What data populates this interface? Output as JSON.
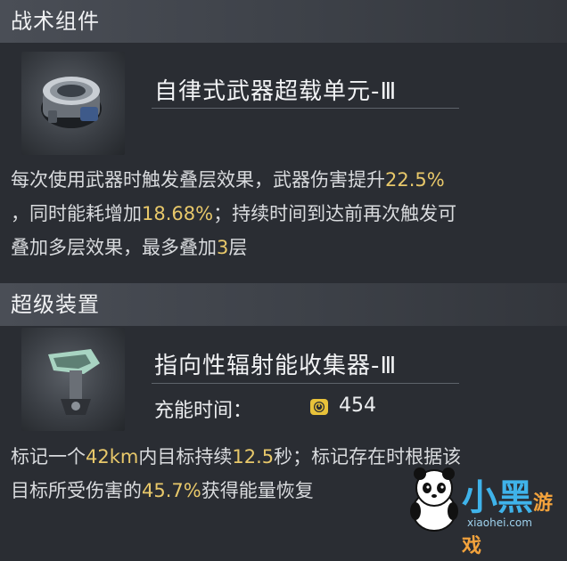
{
  "sections": [
    {
      "title": "战术组件"
    },
    {
      "title": "超级装置"
    }
  ],
  "tactical_component": {
    "name": "自律式武器超载单元-Ⅲ",
    "desc_line1_pre": "每次使用武器时触发叠层效果，武器伤害提升",
    "desc_line1_hl": "22.5%",
    "desc_line2_pre": "，同时能耗增加",
    "desc_line2_hl": "18.68%",
    "desc_line2_post": "；持续时间到达前再次触发可",
    "desc_line3_pre": "叠加多层效果，最多叠加",
    "desc_line3_hl": "3",
    "desc_line3_post": "层"
  },
  "super_device": {
    "name": "指向性辐射能收集器-Ⅲ",
    "charge_label": "充能时间：",
    "charge_value": "454",
    "desc_line1_pre": "标记一个",
    "desc_line1_hl1": "42km",
    "desc_line1_mid": "内目标持续",
    "desc_line1_hl2": "12.5",
    "desc_line1_post": "秒；标记存在时根据该",
    "desc_line2_pre": "目标所受伤害的",
    "desc_line2_hl": "45.7%",
    "desc_line2_post": "获得能量恢复"
  },
  "icons": {
    "charge": "clock-icon",
    "thumb1": "weapon-overload-unit-icon",
    "thumb2": "radiation-collector-icon"
  },
  "watermark": {
    "brand": "小黑游戏",
    "url": "xiaohei.com"
  },
  "colors": {
    "highlight": "#e8c86a",
    "background": "#2a2d33",
    "header": "#4a4e56"
  }
}
